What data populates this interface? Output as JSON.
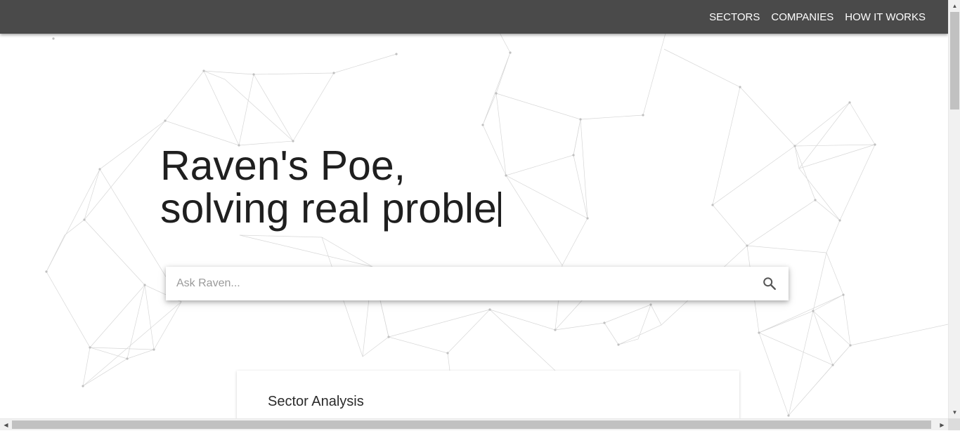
{
  "nav": {
    "items": [
      {
        "label": "SECTORS"
      },
      {
        "label": "COMPANIES"
      },
      {
        "label": "HOW IT WORKS"
      }
    ]
  },
  "hero": {
    "line1": "Raven's Poe,",
    "line2": "solving real proble"
  },
  "search": {
    "placeholder": "Ask Raven...",
    "icon": "search-icon"
  },
  "card": {
    "title": "Sector Analysis"
  },
  "colors": {
    "topbar": "#4a4a4a",
    "background": "#ffffff",
    "text": "#1f1f1f",
    "network_lines": "#c8c8c8"
  }
}
